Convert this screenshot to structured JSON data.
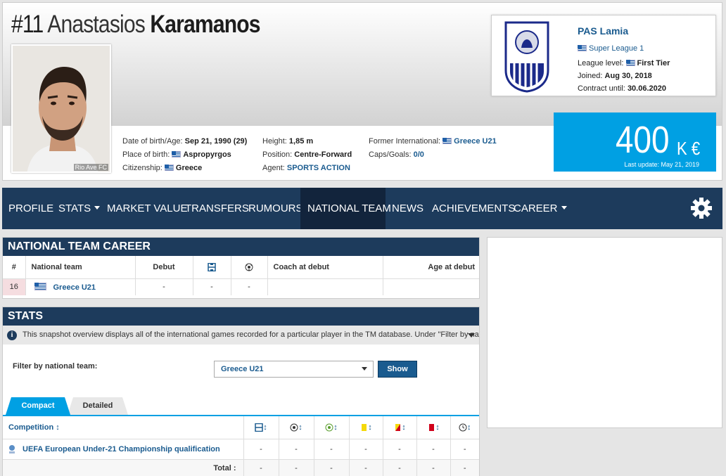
{
  "player": {
    "number": "#11",
    "first_name": "Anastasios",
    "last_name": "Karamanos",
    "photo_caption": "Rio Ave FC"
  },
  "info": {
    "dob_label": "Date of birth/Age:",
    "dob_value": "Sep 21, 1990 (29)",
    "pob_label": "Place of birth:",
    "pob_value": "Aspropyrgos",
    "citizenship_label": "Citizenship:",
    "citizenship_value": "Greece",
    "height_label": "Height:",
    "height_value": "1,85 m",
    "position_label": "Position:",
    "position_value": "Centre-Forward",
    "agent_label": "Agent:",
    "agent_value": "SPORTS ACTION",
    "former_label": "Former International:",
    "former_value": "Greece U21",
    "caps_label": "Caps/Goals:",
    "caps_value": "0/0"
  },
  "club": {
    "name": "PAS Lamia",
    "league": "Super League 1",
    "league_level_label": "League level:",
    "league_level_value": "First Tier",
    "joined_label": "Joined:",
    "joined_value": "Aug 30, 2018",
    "contract_label": "Contract until:",
    "contract_value": "30.06.2020"
  },
  "market_value": {
    "value": "400",
    "unit": "K €",
    "last_update": "Last update: May 21, 2019"
  },
  "nav": {
    "items": [
      "PROFILE",
      "STATS",
      "MARKET VALUE",
      "TRANSFERS",
      "RUMOURS",
      "NATIONAL TEAM",
      "NEWS",
      "ACHIEVEMENTS",
      "CAREER"
    ],
    "active": "NATIONAL TEAM"
  },
  "national_career": {
    "title": "NATIONAL TEAM CAREER",
    "headers": [
      "#",
      "National team",
      "Debut",
      "",
      "",
      "Coach at debut",
      "Age at debut"
    ],
    "rows": [
      {
        "num": "16",
        "team": "Greece U21",
        "debut": "-",
        "apps": "-",
        "goals": "-",
        "coach": "",
        "age": ""
      }
    ]
  },
  "stats": {
    "title": "STATS",
    "info_text": "This snapshot overview displays all of the international games recorded for a particular player in the TM database. Under \"Filter by national te...",
    "filter_label": "Filter by national team:",
    "filter_value": "Greece U21",
    "show_button": "Show",
    "tabs": [
      "Compact",
      "Detailed"
    ],
    "active_tab": "Compact",
    "competition_header": "Competition",
    "rows": [
      {
        "competition": "UEFA European Under-21 Championship qualification",
        "values": [
          "-",
          "-",
          "-",
          "-",
          "-",
          "-",
          "-"
        ]
      }
    ],
    "total_label": "Total :",
    "total_values": [
      "-",
      "-",
      "-",
      "-",
      "-",
      "-",
      "-"
    ]
  },
  "colors": {
    "nav_bg": "#1d3b5c",
    "accent": "#00a0e3",
    "link": "#1a5b8f"
  }
}
